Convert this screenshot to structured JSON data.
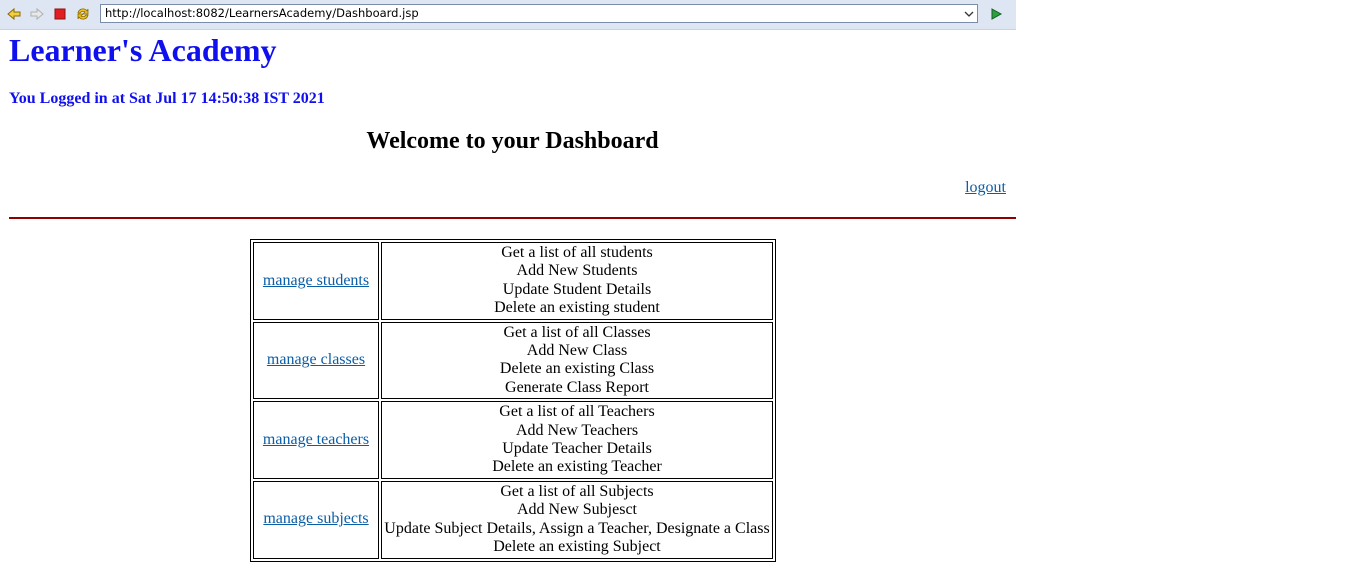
{
  "browser": {
    "url": "http://localhost:8082/LearnersAcademy/Dashboard.jsp",
    "icons": {
      "back": "back-arrow-icon",
      "forward": "forward-arrow-icon",
      "stop": "stop-icon",
      "refresh": "refresh-icon",
      "go": "go-icon",
      "dropdown": "chevron-down-icon"
    }
  },
  "page": {
    "title": "Learner's Academy",
    "login_info": "You Logged in at Sat Jul 17 14:50:38 IST 2021",
    "welcome": "Welcome to your Dashboard",
    "logout_label": "logout"
  },
  "colors": {
    "title_blue": "#1010ee",
    "link_blue": "#0b5ea6",
    "divider_red": "#900000"
  },
  "menu": {
    "rows": [
      {
        "link": "manage students",
        "items": [
          "Get a list of all students",
          "Add New Students",
          "Update Student Details",
          "Delete an existing student"
        ]
      },
      {
        "link": "manage classes",
        "items": [
          "Get a list of all Classes",
          "Add New Class",
          "Delete an existing Class",
          "Generate Class Report"
        ]
      },
      {
        "link": "manage teachers",
        "items": [
          "Get a list of all Teachers",
          "Add New Teachers",
          "Update Teacher Details",
          "Delete an existing Teacher"
        ]
      },
      {
        "link": "manage subjects",
        "items": [
          "Get a list of all Subjects",
          "Add New Subjesct",
          "Update Subject Details, Assign a Teacher, Designate a Class",
          "Delete an existing Subject"
        ]
      }
    ]
  }
}
